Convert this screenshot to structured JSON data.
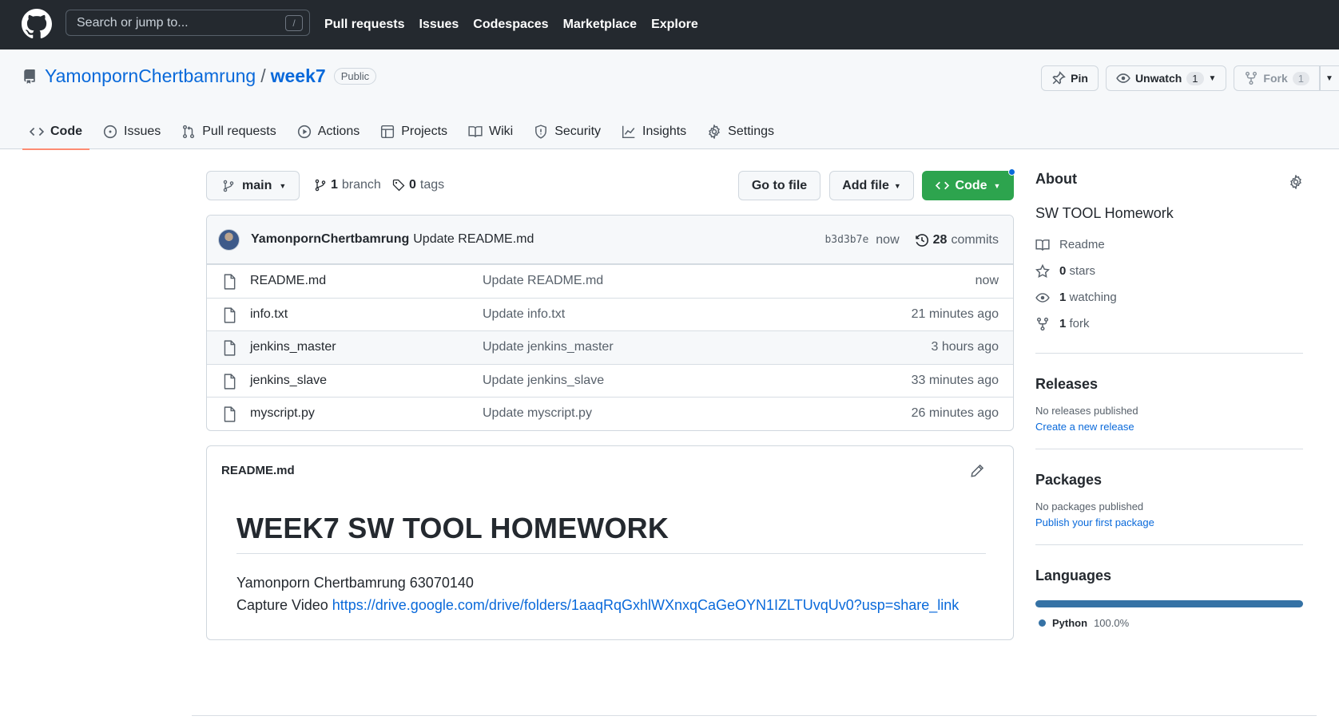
{
  "header": {
    "search_placeholder": "Search or jump to...",
    "search_shortcut": "/",
    "nav": [
      "Pull requests",
      "Issues",
      "Codespaces",
      "Marketplace",
      "Explore"
    ]
  },
  "repo": {
    "owner": "YamonpornChertbamrung",
    "separator": "/",
    "name": "week7",
    "visibility": "Public",
    "pin_label": "Pin",
    "unwatch_label": "Unwatch",
    "unwatch_count": "1",
    "fork_label": "Fork",
    "fork_count": "1"
  },
  "tabs": [
    {
      "label": "Code",
      "icon": "code-icon",
      "active": true
    },
    {
      "label": "Issues",
      "icon": "issue-icon"
    },
    {
      "label": "Pull requests",
      "icon": "pull-request-icon"
    },
    {
      "label": "Actions",
      "icon": "play-icon"
    },
    {
      "label": "Projects",
      "icon": "table-icon"
    },
    {
      "label": "Wiki",
      "icon": "book-icon"
    },
    {
      "label": "Security",
      "icon": "shield-icon"
    },
    {
      "label": "Insights",
      "icon": "graph-icon"
    },
    {
      "label": "Settings",
      "icon": "gear-icon"
    }
  ],
  "filenav": {
    "branch": "main",
    "branch_count": "1",
    "branch_label": "branch",
    "tag_count": "0",
    "tag_label": "tags",
    "goto_label": "Go to file",
    "addfile_label": "Add file",
    "code_label": "Code"
  },
  "commit": {
    "author": "YamonpornChertbamrung",
    "message": "Update README.md",
    "sha": "b3d3b7e",
    "time": "now",
    "count": "28",
    "count_label": "commits"
  },
  "files": [
    {
      "name": "README.md",
      "message": "Update README.md",
      "age": "now"
    },
    {
      "name": "info.txt",
      "message": "Update info.txt",
      "age": "21 minutes ago"
    },
    {
      "name": "jenkins_master",
      "message": "Update jenkins_master",
      "age": "3 hours ago"
    },
    {
      "name": "jenkins_slave",
      "message": "Update jenkins_slave",
      "age": "33 minutes ago"
    },
    {
      "name": "myscript.py",
      "message": "Update myscript.py",
      "age": "26 minutes ago"
    }
  ],
  "readme": {
    "filename": "README.md",
    "heading": "WEEK7 SW TOOL HOMEWORK",
    "line1": "Yamonporn Chertbamrung 63070140",
    "line2_prefix": "Capture Video ",
    "link": "https://drive.google.com/drive/folders/1aaqRqGxhlWXnxqCaGeOYN1IZLTUvqUv0?usp=share_link"
  },
  "sidebar": {
    "about_title": "About",
    "description": "SW TOOL Homework",
    "readme_label": "Readme",
    "stars_count": "0",
    "stars_label": "stars",
    "watching_count": "1",
    "watching_label": "watching",
    "fork_count": "1",
    "fork_label": "fork",
    "releases_title": "Releases",
    "releases_empty": "No releases published",
    "releases_link": "Create a new release",
    "packages_title": "Packages",
    "packages_empty": "No packages published",
    "packages_link": "Publish your first package",
    "languages_title": "Languages",
    "language_name": "Python",
    "language_pct": "100.0%",
    "language_color": "#3572a5"
  },
  "colors": {
    "accent": "#0969da",
    "code_button": "#2da44e",
    "active_tab_underline": "#fd8c73",
    "header_bg": "#24292f"
  }
}
